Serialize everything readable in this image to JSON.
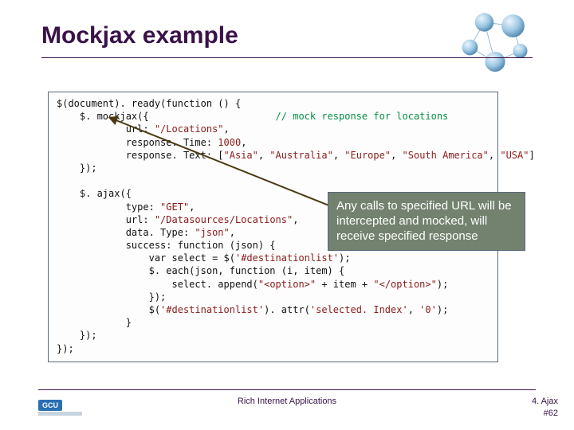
{
  "title": "Mockjax example",
  "code": {
    "l1": "$(document). ready(function () {",
    "l2p": "    $. mockjax({                      ",
    "l2c": "// mock response for locations",
    "l3a": "            url: ",
    "l3b": "\"/Locations\"",
    "l3c": ",",
    "l4a": "            response. Time: ",
    "l4b": "1000",
    "l4c": ",",
    "l5a": "            response. Text: [",
    "l5b": "\"Asia\"",
    "l5c": ", ",
    "l5d": "\"Australia\"",
    "l5e": ", ",
    "l5f": "\"Europe\"",
    "l5g": ", ",
    "l5h": "\"South America\"",
    "l5i": ", ",
    "l5j": "\"USA\"",
    "l5k": "]",
    "l6": "    });",
    "blank": " ",
    "l7": "    $. ajax({",
    "l8a": "            type: ",
    "l8b": "\"GET\"",
    "l8c": ",",
    "l9a": "            url: ",
    "l9b": "\"/Datasources/Locations\"",
    "l9c": ",",
    "l10a": "            data. Type: ",
    "l10b": "\"json\"",
    "l10c": ",",
    "l11": "            success: function (json) {",
    "l12a": "                var select = $(",
    "l12b": "'#destinationlist'",
    "l12c": ");",
    "l13": "                $. each(json, function (i, item) {",
    "l14a": "                    select. append(",
    "l14b": "\"<option>\"",
    "l14c": " + item + ",
    "l14d": "\"</option>\"",
    "l14e": ");",
    "l15": "                });",
    "l16a": "                $(",
    "l16b": "'#destinationlist'",
    "l16c": "). attr(",
    "l16d": "'selected. Index'",
    "l16e": ", ",
    "l16f": "'0'",
    "l16g": ");",
    "l17": "            }",
    "l18": "    });",
    "l19": "});"
  },
  "callout": "Any calls to specified URL will be intercepted and mocked, will receive specified response",
  "footer": {
    "center": "Rich Internet Applications",
    "r1": "4. Ajax",
    "r2": "#62",
    "logo": "GCU"
  }
}
